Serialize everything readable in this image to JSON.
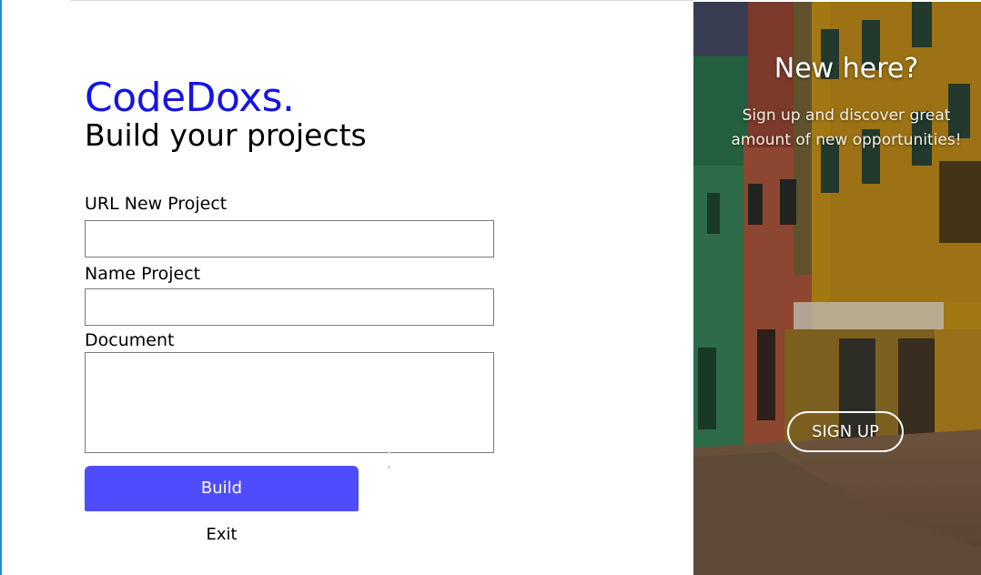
{
  "app": {
    "brand": "CodeDoxs.",
    "subtitle": "Build your projects"
  },
  "form": {
    "url_label": "URL New Project",
    "url_value": "",
    "name_label": "Name Project",
    "name_value": "",
    "document_label": "Document",
    "document_value": "",
    "build_label": "Build",
    "exit_label": "Exit"
  },
  "promo": {
    "title": "New here?",
    "text": "Sign up and discover great amount of new opportunities!",
    "signup_label": "SIGN UP"
  },
  "colors": {
    "brand": "#1414e6",
    "build_button": "#4f4cff",
    "window_edge": "#1e90d6"
  },
  "icons": {
    "promo_background": "colorful-houses-street-image"
  }
}
